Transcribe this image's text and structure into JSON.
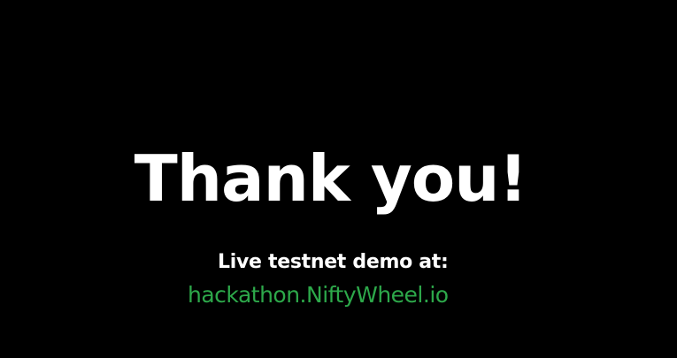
{
  "slide": {
    "heading": "Thank you!",
    "subtitle": "Live testnet demo at:",
    "link_text": "hackathon.NiftyWheel.io"
  },
  "colors": {
    "background": "#000000",
    "text": "#ffffff",
    "link": "#2da84a"
  }
}
